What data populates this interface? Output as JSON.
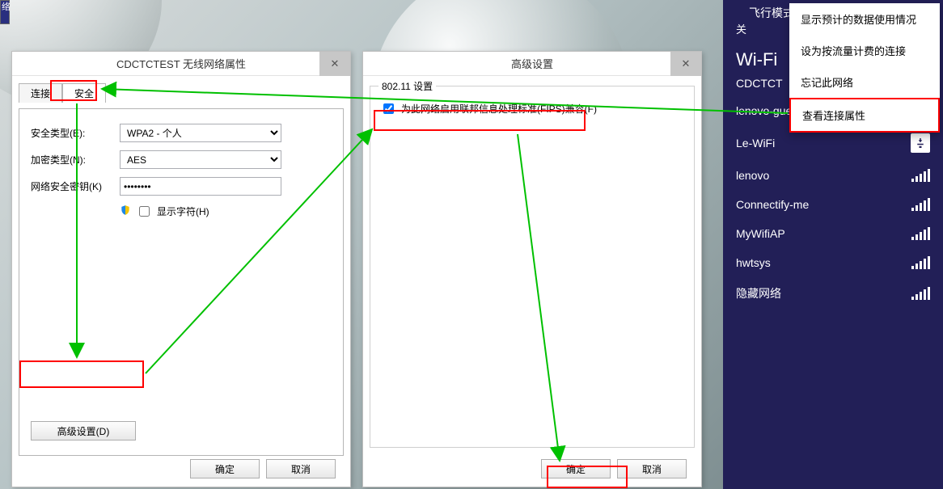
{
  "charms": {
    "airplane_label": "飞行模式",
    "airplane_state": "关",
    "wifi_heading": "Wi-Fi",
    "current_ssid": "CDCTCT",
    "networks": [
      {
        "ssid": "lenovo-guest",
        "secure": true
      },
      {
        "ssid": "Le-WiFi",
        "usb": true
      },
      {
        "ssid": "lenovo"
      },
      {
        "ssid": "Connectify-me"
      },
      {
        "ssid": "MyWifiAP"
      },
      {
        "ssid": "hwtsys"
      },
      {
        "ssid": "隐藏网络"
      }
    ],
    "context_menu": [
      "显示预计的数据使用情况",
      "设为按流量计费的连接",
      "忘记此网络",
      "查看连接属性"
    ]
  },
  "props_dialog": {
    "title": "CDCTCTEST 无线网络属性",
    "tabs": {
      "connect": "连接",
      "security": "安全"
    },
    "security_type_label": "安全类型(E):",
    "security_type_value": "WPA2 - 个人",
    "encrypt_label": "加密类型(N):",
    "encrypt_value": "AES",
    "key_label": "网络安全密钥(K)",
    "key_value": "••••••••",
    "show_chars": "显示字符(H)",
    "advanced_btn": "高级设置(D)",
    "ok": "确定",
    "cancel": "取消"
  },
  "adv_dialog": {
    "title": "高级设置",
    "group": "802.11 设置",
    "fips_label": "为此网络启用联邦信息处理标准(FIPS)兼容(F)",
    "ok": "确定",
    "cancel": "取消"
  }
}
